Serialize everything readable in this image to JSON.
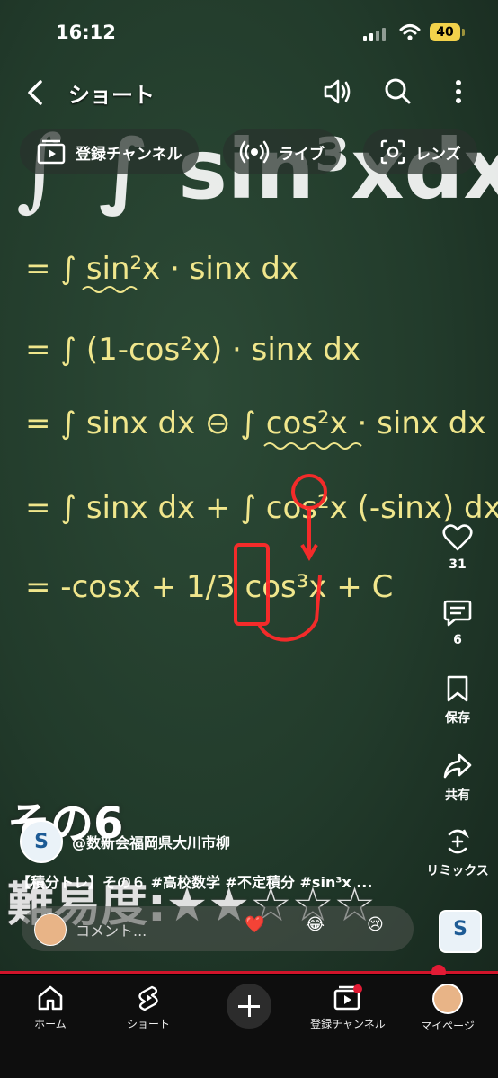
{
  "status": {
    "time": "16:12",
    "battery": "40"
  },
  "topbar": {
    "title": "ショート",
    "back_icon": "chevron-left-icon",
    "sound_icon": "speaker-icon",
    "search_icon": "search-icon",
    "more_icon": "more-vertical-icon"
  },
  "chips": [
    {
      "label": "登録チャンネル",
      "icon": "subscriptions-icon"
    },
    {
      "label": "ライブ",
      "icon": "live-icon"
    },
    {
      "label": "レンズ",
      "icon": "lens-icon"
    }
  ],
  "video": {
    "math_lines": [
      "∫ sin³xdx",
      "= ∫ sin²x · sinx dx",
      "= ∫ (1-cos²x) · sinx dx",
      "= ∫ sinx dx ⊖ ∫ cos²x · sinx dx",
      "= ∫ sinx dx + ∫ cos²x (-sinx) dx",
      "= -cosx + 1/3 cos³x + C"
    ],
    "overlay_big": "その6",
    "overlay_stars": "難易度:★★☆☆☆"
  },
  "rail": {
    "likes": "31",
    "comments": "6",
    "save_label": "保存",
    "share_label": "共有",
    "remix_label": "リミックス"
  },
  "channel": {
    "name": "@数新会福岡県大川市柳",
    "logo_text": "S"
  },
  "video_title": "【積分トレ】その６ #高校数学 #不定積分 #sin³x ...",
  "comment_box": {
    "placeholder": "コメント...",
    "emojis": [
      "❤️",
      "😂",
      "😢"
    ]
  },
  "subscribe_logo": "S",
  "colors": {
    "accent": "#e21b35",
    "chalk": "#f0e68c",
    "battery": "#f2d24b"
  },
  "nav": [
    {
      "label": "ホーム",
      "icon": "home-icon"
    },
    {
      "label": "ショート",
      "icon": "shorts-icon"
    },
    {
      "label": "",
      "icon": "create-plus-icon"
    },
    {
      "label": "登録チャンネル",
      "icon": "subscriptions-icon"
    },
    {
      "label": "マイページ",
      "icon": "avatar"
    }
  ]
}
